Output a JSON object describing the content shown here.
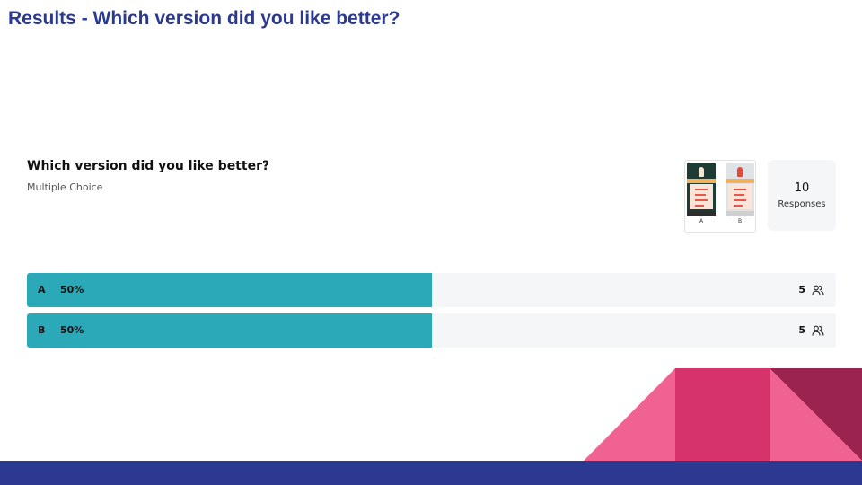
{
  "page": {
    "title": "Results - Which version did you like better?"
  },
  "question": {
    "title": "Which version did you like better?",
    "type": "Multiple Choice",
    "thumbnail_labels": [
      "A",
      "B"
    ]
  },
  "responses": {
    "count": "10",
    "label": "Responses"
  },
  "results": [
    {
      "option": "A",
      "percent_label": "50%",
      "share": 0.5,
      "count": "5",
      "icon": "people-icon"
    },
    {
      "option": "B",
      "percent_label": "50%",
      "share": 0.5,
      "count": "5",
      "icon": "people-icon"
    }
  ],
  "colors": {
    "title": "#2b3990",
    "bar_fill": "#2ca9b8",
    "bar_track": "#f5f6f8",
    "footer": "#2b3990",
    "decor_pink": "#f06292",
    "decor_magenta": "#d6336c",
    "decor_maroon": "#9b234f"
  }
}
